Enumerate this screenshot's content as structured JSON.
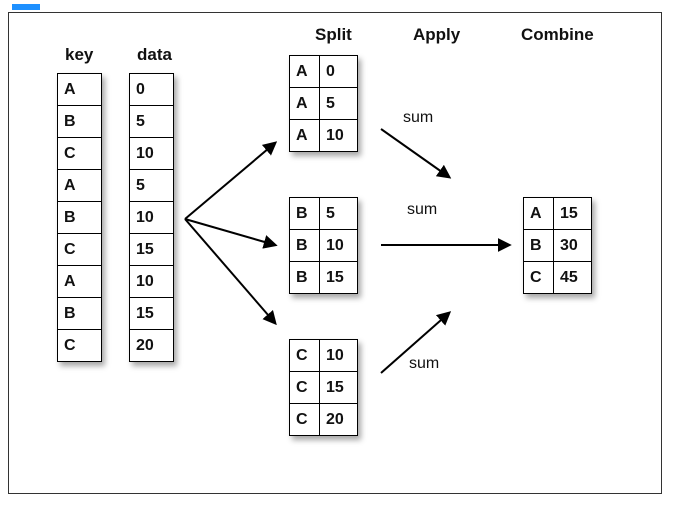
{
  "headings": {
    "key": "key",
    "data": "data",
    "split": "Split",
    "apply": "Apply",
    "combine": "Combine"
  },
  "original": {
    "keys": [
      "A",
      "B",
      "C",
      "A",
      "B",
      "C",
      "A",
      "B",
      "C"
    ],
    "data": [
      "0",
      "5",
      "10",
      "5",
      "10",
      "15",
      "10",
      "15",
      "20"
    ]
  },
  "split_groups": [
    {
      "key": "A",
      "rows": [
        [
          "A",
          "0"
        ],
        [
          "A",
          "5"
        ],
        [
          "A",
          "10"
        ]
      ]
    },
    {
      "key": "B",
      "rows": [
        [
          "B",
          "5"
        ],
        [
          "B",
          "10"
        ],
        [
          "B",
          "15"
        ]
      ]
    },
    {
      "key": "C",
      "rows": [
        [
          "C",
          "10"
        ],
        [
          "C",
          "15"
        ],
        [
          "C",
          "20"
        ]
      ]
    }
  ],
  "apply": {
    "op": "sum",
    "labels": [
      "sum",
      "sum",
      "sum"
    ]
  },
  "combine": {
    "rows": [
      [
        "A",
        "15"
      ],
      [
        "B",
        "30"
      ],
      [
        "C",
        "45"
      ]
    ]
  }
}
